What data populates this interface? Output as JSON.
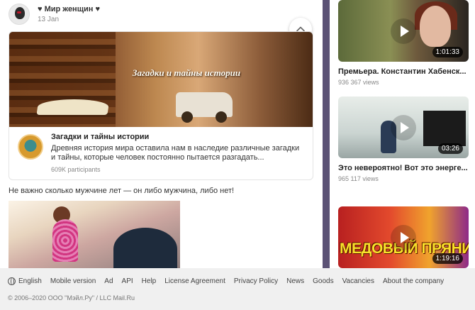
{
  "post": {
    "author": "♥ Мир женщин ♥",
    "date": "13 Jan",
    "text": "Не важно сколько мужчине лет — он либо мужчина, либо нет!"
  },
  "group_card": {
    "banner_title": "Загадки и тайны истории",
    "title": "Загадки и тайны истории",
    "description": "Древняя история мира оставила нам в наследие различные загадки и тайны, которые человек постоянно пытается разгадать...",
    "participants": "609K participants"
  },
  "videos": [
    {
      "title": "Премьера. Константин Хабенск...",
      "views": "936 367 views",
      "duration": "1:01:33"
    },
    {
      "title": "Это невероятно! Вот это энерге...",
      "views": "965 117 views",
      "duration": "03:26"
    },
    {
      "title": "",
      "views": "",
      "duration": "1:19:16",
      "thumb_text": "МЕДОВЫЙ ПРЯНИК"
    }
  ],
  "footer": {
    "language": "English",
    "links": [
      "Mobile version",
      "Ad",
      "API",
      "Help",
      "License Agreement",
      "Privacy Policy",
      "News",
      "Goods",
      "Vacancies",
      "About the company"
    ],
    "copyright": "© 2006–2020 ООО \"Мэйл.Ру\" / LLC Mail.Ru"
  },
  "colors": {
    "divider": "#5b5275",
    "background": "#f0f0f0",
    "text": "#333333",
    "muted": "#888888"
  },
  "icons": {
    "collapse": "chevron-up-icon",
    "play": "play-icon",
    "language": "globe-icon"
  }
}
